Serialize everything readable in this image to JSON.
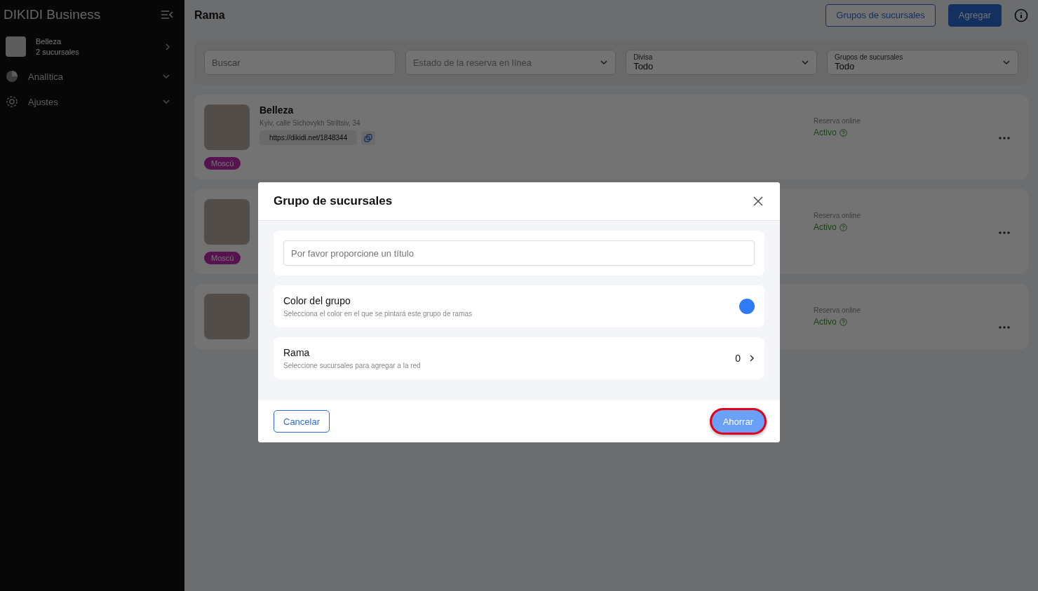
{
  "sidebar": {
    "brand": "DIKIDI Business",
    "account": {
      "name": "Belleza",
      "subtitle": "2 sucursales"
    },
    "items": [
      {
        "kind": "analytics",
        "label": "Analítica",
        "expanded": false
      },
      {
        "kind": "settings",
        "label": "Ajustes",
        "expanded": false
      }
    ]
  },
  "header": {
    "title": "Rama",
    "buttons": [
      {
        "label": "Grupos de sucursales",
        "kind": "outline"
      },
      {
        "label": "Agregar",
        "kind": "primary"
      }
    ]
  },
  "filters": {
    "search": {
      "placeholder": "Buscar"
    },
    "selects": [
      {
        "placeholder": "Estado de la reserva en línea"
      },
      {
        "label": "Divisa",
        "value": "Todo"
      },
      {
        "label": "Grupos de sucursales",
        "value": "Todo"
      }
    ]
  },
  "branches": [
    {
      "name": "Belleza",
      "address": "Kyiv, calle Sichovykh Striltsiv, 34",
      "link": "https://dikidi.net/1848344",
      "tag": {
        "label": "Moscú"
      },
      "status_label": "Reserva online",
      "status": "Activo"
    },
    {
      "tag": {
        "label": "Moscú"
      },
      "status_label": "Reserva online",
      "status": "Activo"
    },
    {
      "status_label": "Reserva online",
      "status": "Activo"
    }
  ],
  "dialog": {
    "title": "Grupo de sucursales",
    "title_field": {
      "placeholder": "Por favor proporcione un título"
    },
    "color_row": {
      "title": "Color del grupo",
      "subtitle": "Selecciona el color en el que se pintará este grupo de ramas",
      "color": "#2d7cf6"
    },
    "branch_row": {
      "title": "Rama",
      "subtitle": "Seleccione sucursales para agregar a la red",
      "count": "0"
    },
    "cancel": "Cancelar",
    "save": {
      "label": "Ahorrar",
      "highlighted": true
    }
  }
}
